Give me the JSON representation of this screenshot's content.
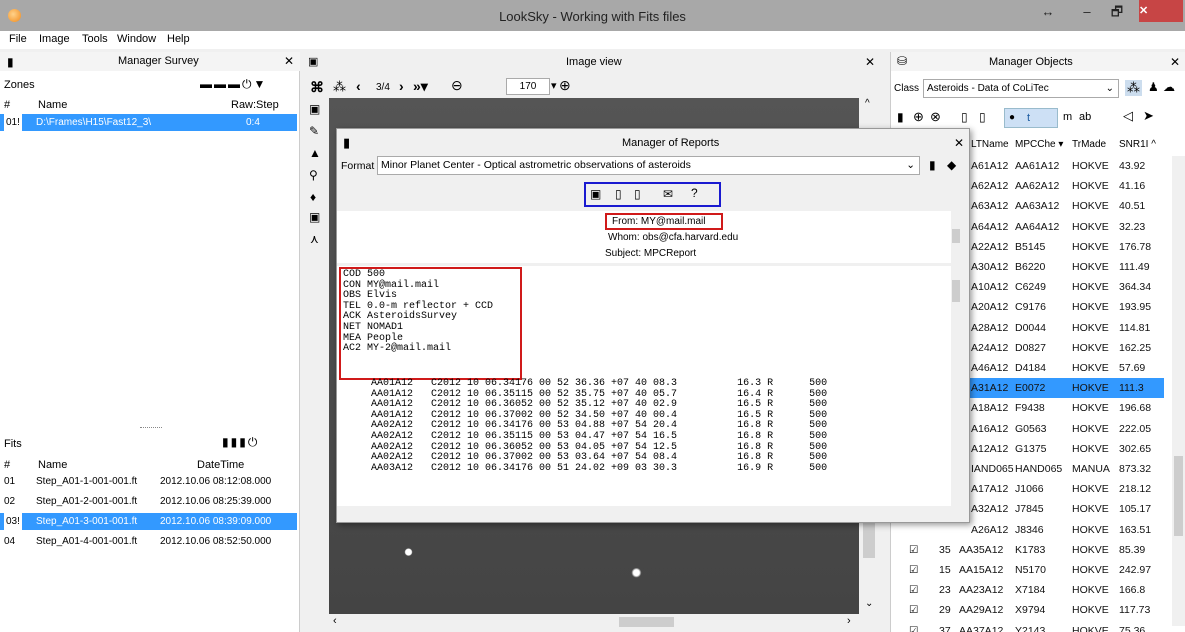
{
  "window": {
    "title": "LookSky - Working with Fits files",
    "restore_glyph": "↔",
    "min_glyph": "–",
    "max_glyph": "🗗",
    "close_glyph": "✕"
  },
  "menu": [
    "File",
    "Image",
    "Tools",
    "Window",
    "Help"
  ],
  "survey": {
    "title": "Manager Survey",
    "close": "✕",
    "zones_label": "Zones",
    "col_num": "#",
    "col_name": "Name",
    "col_raw": "Raw:Step",
    "zones": [
      {
        "num": "01!",
        "name": "D:\\Frames\\H15\\Fast12_3\\",
        "raw": "0:4"
      }
    ],
    "fits_label": "Fits",
    "fits_col_num": "#",
    "fits_col_name": "Name",
    "fits_col_date": "DateTime",
    "fits": [
      {
        "num": "01",
        "name": "Step_A01-1-001-001.ft",
        "date": "2012.10.06 08:12:08.000"
      },
      {
        "num": "02",
        "name": "Step_A01-2-001-001.ft",
        "date": "2012.10.06 08:25:39.000"
      },
      {
        "num": "03!",
        "name": "Step_A01-3-001-001.ft",
        "date": "2012.10.06 08:39:09.000"
      },
      {
        "num": "04",
        "name": "Step_A01-4-001-001.ft",
        "date": "2012.10.06 08:52:50.000"
      }
    ]
  },
  "imageview": {
    "title": "Image view",
    "close": "✕",
    "frame": "3/4",
    "zoom": "170"
  },
  "reports": {
    "title": "Manager of Reports",
    "close": "✕",
    "format_label": "Format",
    "format_value": "Minor Planet Center - Optical astrometric observations of asteroids",
    "from": "From:  MY@mail.mail",
    "whom": "Whom:  obs@cfa.harvard.edu",
    "subject": "Subject:  MPCReport",
    "header_lines": [
      "COD 500",
      "CON MY@mail.mail",
      "OBS Elvis",
      "TEL 0.0-m reflector + CCD",
      "ACK AsteroidsSurvey",
      "NET NOMAD1",
      "MEA People",
      "AC2 MY-2@mail.mail"
    ],
    "obs_lines": [
      "     AA01A12   C2012 10 06.34176 00 52 36.36 +07 40 08.3          16.3 R      500",
      "     AA01A12   C2012 10 06.35115 00 52 35.75 +07 40 05.7          16.4 R      500",
      "     AA01A12   C2012 10 06.36052 00 52 35.12 +07 40 02.9          16.5 R      500",
      "     AA01A12   C2012 10 06.37002 00 52 34.50 +07 40 00.4          16.5 R      500",
      "     AA02A12   C2012 10 06.34176 00 53 04.88 +07 54 20.4          16.8 R      500",
      "     AA02A12   C2012 10 06.35115 00 53 04.47 +07 54 16.5          16.8 R      500",
      "     AA02A12   C2012 10 06.36052 00 53 04.05 +07 54 12.5          16.8 R      500",
      "     AA02A12   C2012 10 06.37002 00 53 03.64 +07 54 08.4          16.8 R      500",
      "     AA03A12   C2012 10 06.34176 00 51 24.02 +09 03 30.3          16.9 R      500"
    ]
  },
  "objects": {
    "title": "Manager Objects",
    "close": "✕",
    "class_label": "Class",
    "class_value": "Asteroids - Data of CoLiTec",
    "t_label": "t",
    "m_label": "m",
    "ab_label": "ab",
    "cols": [
      "LTName",
      "MPCChe ▾",
      "TrMade",
      "SNR1I ^"
    ],
    "rows": [
      {
        "lt": "A61A12",
        "mpc": "AA61A12",
        "tr": "HOKVE",
        "snr": "43.92"
      },
      {
        "lt": "A62A12",
        "mpc": "AA62A12",
        "tr": "HOKVE",
        "snr": "41.16"
      },
      {
        "lt": "A63A12",
        "mpc": "AA63A12",
        "tr": "HOKVE",
        "snr": "40.51"
      },
      {
        "lt": "A64A12",
        "mpc": "AA64A12",
        "tr": "HOKVE",
        "snr": "32.23"
      },
      {
        "lt": "A22A12",
        "mpc": "B5145",
        "tr": "HOKVE",
        "snr": "176.78"
      },
      {
        "lt": "A30A12",
        "mpc": "B6220",
        "tr": "HOKVE",
        "snr": "111.49"
      },
      {
        "lt": "A10A12",
        "mpc": "C6249",
        "tr": "HOKVE",
        "snr": "364.34"
      },
      {
        "lt": "A20A12",
        "mpc": "C9176",
        "tr": "HOKVE",
        "snr": "193.95"
      },
      {
        "lt": "A28A12",
        "mpc": "D0044",
        "tr": "HOKVE",
        "snr": "114.81"
      },
      {
        "lt": "A24A12",
        "mpc": "D0827",
        "tr": "HOKVE",
        "snr": "162.25"
      },
      {
        "lt": "A46A12",
        "mpc": "D4184",
        "tr": "HOKVE",
        "snr": "57.69"
      },
      {
        "lt": "A31A12",
        "mpc": "E0072",
        "tr": "HOKVE",
        "snr": "111.3"
      },
      {
        "lt": "A18A12",
        "mpc": "F9438",
        "tr": "HOKVE",
        "snr": "196.68"
      },
      {
        "lt": "A16A12",
        "mpc": "G0563",
        "tr": "HOKVE",
        "snr": "222.05"
      },
      {
        "lt": "A12A12",
        "mpc": "G1375",
        "tr": "HOKVE",
        "snr": "302.65"
      },
      {
        "lt": "IAND065",
        "mpc": "HAND065",
        "tr": "MANUA",
        "snr": "873.32"
      },
      {
        "lt": "A17A12",
        "mpc": "J1066",
        "tr": "HOKVE",
        "snr": "218.12"
      },
      {
        "lt": "A32A12",
        "mpc": "J7845",
        "tr": "HOKVE",
        "snr": "105.17"
      },
      {
        "lt": "A26A12",
        "mpc": "J8346",
        "tr": "HOKVE",
        "snr": "163.51"
      }
    ],
    "checked_rows": [
      {
        "n": "35",
        "lt": "AA35A12",
        "mpc": "K1783",
        "tr": "HOKVE",
        "snr": "85.39"
      },
      {
        "n": "15",
        "lt": "AA15A12",
        "mpc": "N5170",
        "tr": "HOKVE",
        "snr": "242.97"
      },
      {
        "n": "23",
        "lt": "AA23A12",
        "mpc": "X7184",
        "tr": "HOKVE",
        "snr": "166.8"
      },
      {
        "n": "29",
        "lt": "AA29A12",
        "mpc": "X9794",
        "tr": "HOKVE",
        "snr": "117.73"
      },
      {
        "n": "37",
        "lt": "AA37A12",
        "mpc": "Y2143",
        "tr": "HOKVE",
        "snr": "75.36"
      }
    ]
  }
}
